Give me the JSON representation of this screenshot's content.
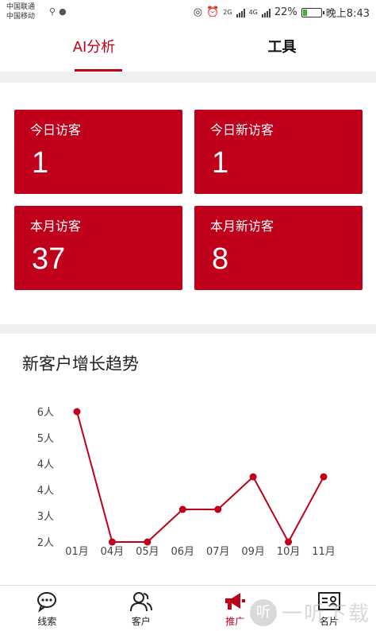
{
  "status_bar": {
    "carrier1": "中国联通",
    "carrier2": "中国移动",
    "net1": "2G",
    "net2": "4G",
    "battery": "22%",
    "battery_level": 0.22,
    "time": "晚上8:43"
  },
  "tabs": [
    {
      "label": "AI分析",
      "active": true
    },
    {
      "label": "工具",
      "active": false
    }
  ],
  "stats": [
    {
      "label": "今日访客",
      "value": "1"
    },
    {
      "label": "今日新访客",
      "value": "1"
    },
    {
      "label": "本月访客",
      "value": "37"
    },
    {
      "label": "本月新访客",
      "value": "8"
    }
  ],
  "trend": {
    "title": "新客户增长趋势"
  },
  "chart_data": {
    "type": "line",
    "title": "新客户增长趋势",
    "categories": [
      "01月",
      "04月",
      "05月",
      "06月",
      "07月",
      "09月",
      "10月",
      "11月"
    ],
    "values": [
      6,
      2,
      2,
      3,
      3,
      4,
      2,
      4
    ],
    "y_tick_labels": [
      "2人",
      "3人",
      "4人",
      "4人",
      "5人",
      "6人"
    ],
    "ylim": [
      2,
      6
    ],
    "grid": false,
    "line_color": "#c0001a"
  },
  "bottom_nav": [
    {
      "label": "线索",
      "icon": "chat-bubble-icon"
    },
    {
      "label": "客户",
      "icon": "users-icon"
    },
    {
      "label": "推广",
      "icon": "megaphone-icon",
      "active": true
    },
    {
      "label": "名片",
      "icon": "id-card-icon"
    }
  ],
  "watermark": {
    "glyph": "听",
    "text": "一听下载"
  },
  "colors": {
    "accent": "#c0001a"
  }
}
